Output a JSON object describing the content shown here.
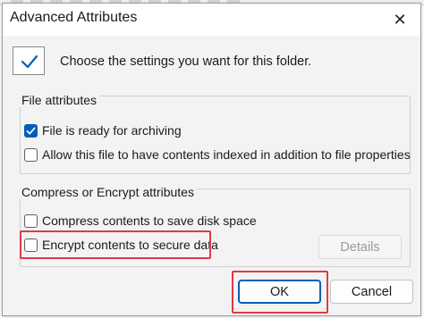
{
  "dialog": {
    "title": "Advanced Attributes",
    "close_glyph": "✕",
    "close_icon": "close-icon"
  },
  "intro": {
    "text": "Choose the settings you want for this folder.",
    "icon": "folder-checkmark-icon"
  },
  "file_attributes": {
    "label": "File attributes",
    "options": [
      {
        "label": "File is ready for archiving",
        "checked": true
      },
      {
        "label": "Allow this file to have contents indexed in addition to file properties",
        "checked": false
      }
    ]
  },
  "compress_encrypt": {
    "label": "Compress or Encrypt attributes",
    "options": [
      {
        "label": "Compress contents to save disk space",
        "checked": false
      },
      {
        "label": "Encrypt contents to secure data",
        "checked": false
      }
    ],
    "details_label": "Details",
    "details_enabled": false
  },
  "buttons": {
    "ok_label": "OK",
    "cancel_label": "Cancel"
  },
  "colors": {
    "accent": "#005fb8",
    "highlight": "#e03a45"
  }
}
